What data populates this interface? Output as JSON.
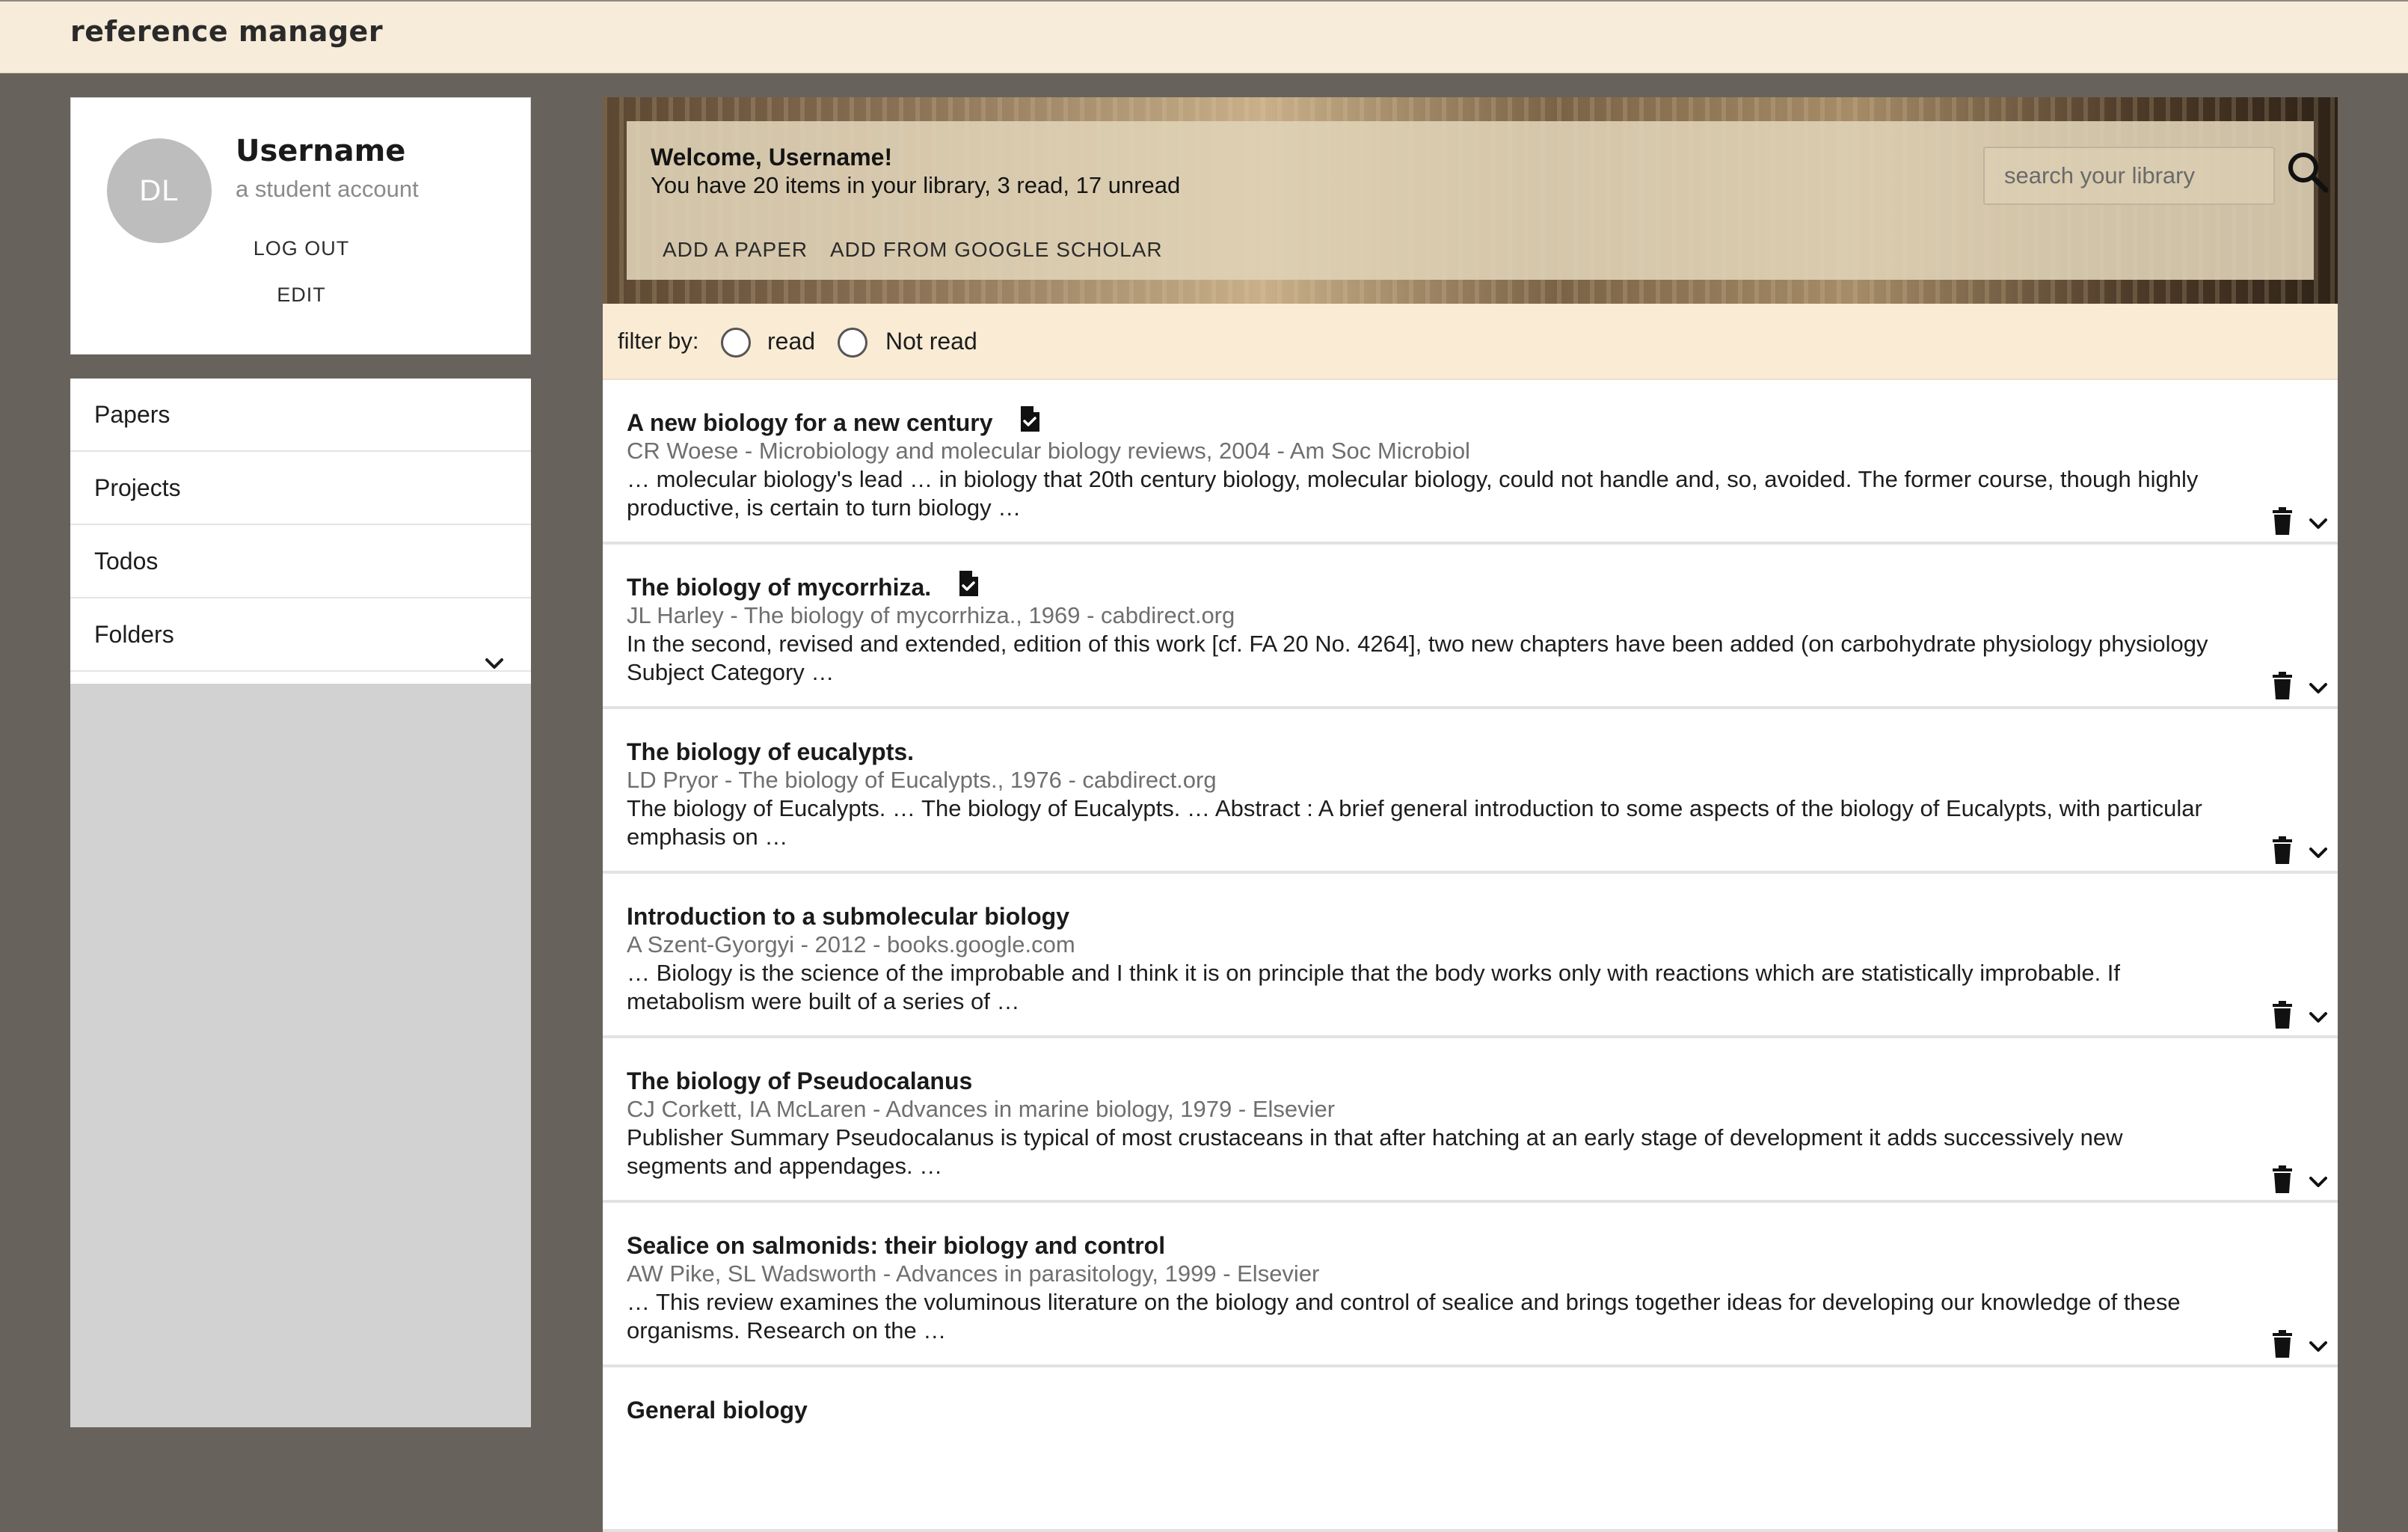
{
  "app": {
    "title": "reference manager"
  },
  "profile": {
    "initials": "DL",
    "username": "Username",
    "account_type": "a student account",
    "logout_label": "LOG OUT",
    "edit_label": "EDIT"
  },
  "sidebar": {
    "items": [
      {
        "label": "Papers"
      },
      {
        "label": "Projects"
      },
      {
        "label": "Todos"
      },
      {
        "label": "Folders",
        "icon": "chevron-down-icon"
      }
    ]
  },
  "header": {
    "welcome": "Welcome, Username!",
    "summary": "You have 20 items in your library, 3 read, 17 unread",
    "add_paper_label": "ADD A PAPER",
    "add_scholar_label": "ADD FROM GOOGLE SCHOLAR",
    "search_placeholder": "search your library",
    "search_icon": "search-icon"
  },
  "filter": {
    "label": "filter by:",
    "options": [
      {
        "label": "read",
        "selected": false
      },
      {
        "label": "Not read",
        "selected": false
      }
    ]
  },
  "papers": [
    {
      "title": "A new biology for a new century",
      "has_pdf": true,
      "meta": "CR Woese - Microbiology and molecular biology reviews, 2004 - Am Soc Microbiol",
      "snippet": "… molecular biology's lead … in biology that 20th century biology, molecular biology, could not handle and, so, avoided. The former course, though highly productive, is certain to turn biology …"
    },
    {
      "title": "The biology of mycorrhiza.",
      "has_pdf": true,
      "meta": "JL Harley - The biology of mycorrhiza., 1969 - cabdirect.org",
      "snippet": "In the second, revised and extended, edition of this work [cf. FA 20 No. 4264], two new chapters have been added (on carbohydrate physiology physiology Subject Category …"
    },
    {
      "title": "The biology of eucalypts.",
      "has_pdf": false,
      "meta": "LD Pryor - The biology of Eucalypts., 1976 - cabdirect.org",
      "snippet": "The biology of Eucalypts. … The biology of Eucalypts. … Abstract : A brief general introduction to some aspects of the biology of Eucalypts, with particular emphasis on …"
    },
    {
      "title": "Introduction to a submolecular biology",
      "has_pdf": false,
      "meta": "A Szent-Gyorgyi - 2012 - books.google.com",
      "snippet": "… Biology is the science of the improbable and I think it is on principle that the body works only with reactions which are statistically improbable. If metabolism were built of a series of …"
    },
    {
      "title": "The biology of Pseudocalanus",
      "has_pdf": false,
      "meta": "CJ Corkett, IA McLaren - Advances in marine biology, 1979 - Elsevier",
      "snippet": "Publisher Summary Pseudocalanus is typical of most crustaceans in that after hatching at an early stage of development it adds successively new segments and appendages. …"
    },
    {
      "title": "Sealice on salmonids: their biology and control",
      "has_pdf": false,
      "meta": "AW Pike, SL Wadsworth - Advances in parasitology, 1999 - Elsevier",
      "snippet": "… This review examines the voluminous literature on the biology and control of sealice and brings together ideas for developing our knowledge of these organisms. Research on the …"
    },
    {
      "title": "General biology",
      "has_pdf": false,
      "meta": "",
      "snippet": ""
    }
  ]
}
